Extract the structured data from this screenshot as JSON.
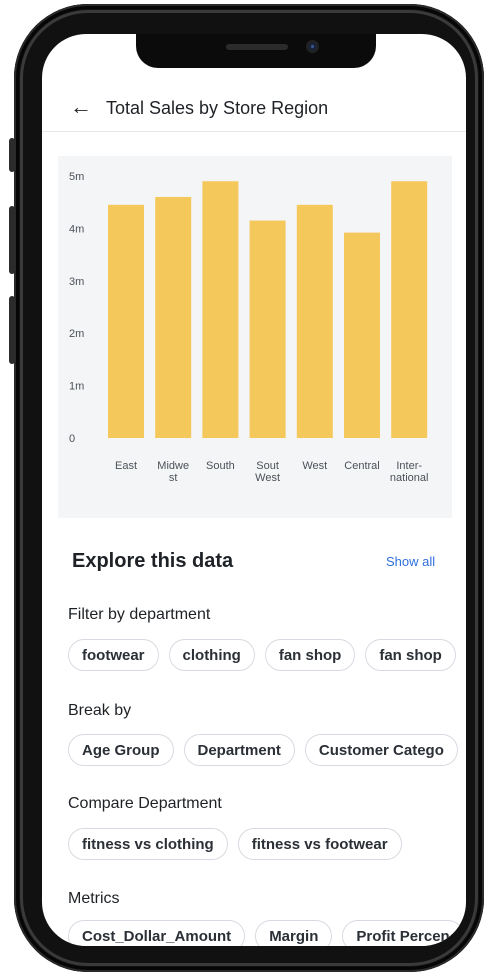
{
  "header": {
    "back_icon": "arrow-left-icon",
    "title": "Total Sales by Store Region"
  },
  "chart_data": {
    "type": "bar",
    "categories": [
      "East",
      "Midwest",
      "South",
      "SoutWest",
      "West",
      "Central",
      "International"
    ],
    "category_labels": [
      [
        "East"
      ],
      [
        "Midwe",
        "st"
      ],
      [
        "South"
      ],
      [
        "Sout",
        "West"
      ],
      [
        "West"
      ],
      [
        "Central"
      ],
      [
        "Inter-",
        "national"
      ]
    ],
    "values": [
      4.45,
      4.6,
      4.9,
      4.15,
      4.45,
      3.92,
      4.9
    ],
    "ylim": [
      0,
      5
    ],
    "yticks": [
      "0",
      "1m",
      "2m",
      "3m",
      "4m",
      "5m"
    ],
    "color": "#f5c85c",
    "grid": false
  },
  "explore": {
    "title": "Explore this data",
    "show_all": "Show all"
  },
  "sections": {
    "filter": {
      "label": "Filter by department",
      "chips": [
        "footwear",
        "clothing",
        "fan shop",
        "fan shop"
      ]
    },
    "break": {
      "label": "Break by",
      "chips": [
        "Age Group",
        "Department",
        "Customer Catego"
      ]
    },
    "compare": {
      "label": "Compare Department",
      "chips": [
        "fitness vs clothing",
        "fitness vs footwear"
      ]
    },
    "metrics": {
      "label": "Metrics",
      "chips": [
        "Cost_Dollar_Amount",
        "Margin",
        "Profit Percen"
      ]
    }
  }
}
